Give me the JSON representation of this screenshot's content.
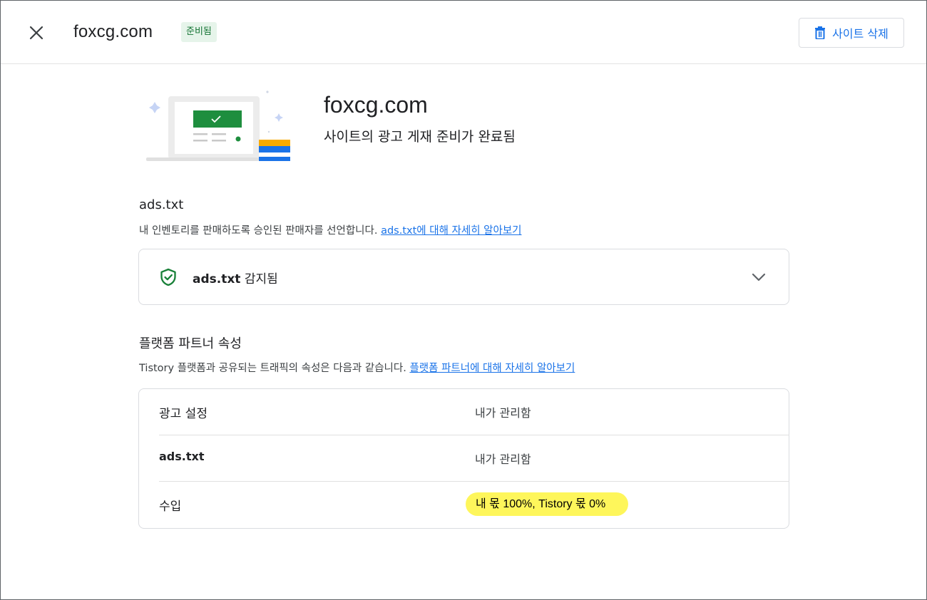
{
  "header": {
    "title": "foxcg.com",
    "status_badge": "준비됨",
    "delete_button": "사이트 삭제"
  },
  "hero": {
    "title": "foxcg.com",
    "subtitle": "사이트의 광고 게재 준비가 완료됨"
  },
  "ads_txt": {
    "title": "ads.txt",
    "description": "내 인벤토리를 판매하도록 승인된 판매자를 선언합니다. ",
    "learn_more": "ads.txt에 대해 자세히 알아보기",
    "status_bold": "ads.txt",
    "status_text": " 감지됨"
  },
  "platform": {
    "title": "플랫폼 파트너 속성",
    "description": "Tistory 플랫폼과 공유되는 트래픽의 속성은 다음과 같습니다. ",
    "learn_more": "플랫폼 파트너에 대해 자세히 알아보기",
    "rows": [
      {
        "key": "광고 설정",
        "value": "내가 관리함"
      },
      {
        "key": "ads.txt",
        "value": "내가 관리함"
      },
      {
        "key": "수입",
        "value": "내 몫 100%, Tistory 몫 0%"
      }
    ]
  },
  "icons": {
    "close": "close-icon",
    "delete": "trash-icon",
    "shield": "shield-check-icon",
    "chevron": "chevron-down-icon"
  },
  "colors": {
    "accent": "#1a73e8",
    "success": "#188038",
    "badge_bg": "#e6f4ea",
    "highlight": "#fef65b"
  }
}
